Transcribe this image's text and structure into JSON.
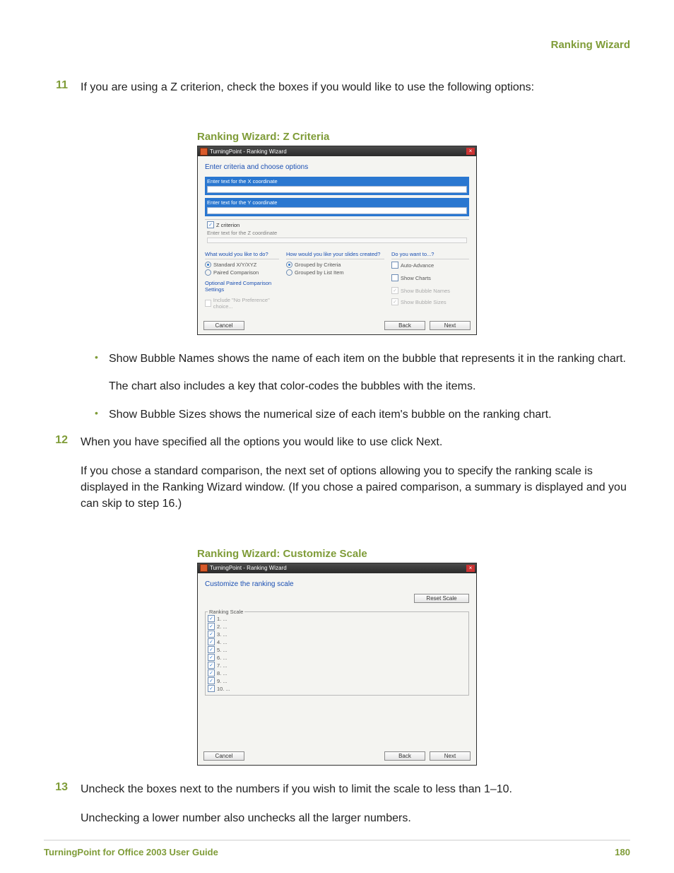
{
  "running_head": "Ranking Wizard",
  "step11": {
    "num": "11",
    "text": "If you are using a Z criterion, check the boxes if you would like to use the following options:"
  },
  "figure1": {
    "caption": "Ranking Wizard: Z Criteria",
    "title_bar": "TurningPoint - Ranking Wizard",
    "heading": "Enter criteria and choose options",
    "x_label": "Enter text for the X coordinate",
    "y_label": "Enter text for the Y coordinate",
    "z_check": "Z criterion",
    "z_label": "Enter text for the Z coordinate",
    "col1_head": "What would you like to do?",
    "col1_opt1": "Standard X/Y/XYZ",
    "col1_opt2": "Paired Comparison",
    "col1_sub": "Optional Paired Comparison Settings",
    "col1_sub_opt": "Include \"No Preference\" choice...",
    "col2_head": "How would you like your slides created?",
    "col2_opt1": "Grouped by Criteria",
    "col2_opt2": "Grouped by List Item",
    "col3_head": "Do you want to...?",
    "col3_opt1": "Auto-Advance",
    "col3_opt2": "Show Charts",
    "col3_opt3": "Show Bubble Names",
    "col3_opt4": "Show Bubble Sizes",
    "btn_cancel": "Cancel",
    "btn_back": "Back",
    "btn_next": "Next"
  },
  "bullet1_a": "Show Bubble Names shows the name of each item on the bubble that represents it in the ranking chart.",
  "bullet1_b": "The chart also includes a key that color-codes the bubbles with the items.",
  "bullet2": "Show Bubble Sizes shows the numerical size of each item's bubble on the ranking chart.",
  "step12": {
    "num": "12",
    "a": "When you have specified all the options you would like to use click Next.",
    "b": "If you chose a standard comparison, the next set of options allowing you to specify the ranking scale is displayed in the Ranking Wizard window. (If you chose a paired comparison, a summary is displayed and you can skip to step 16.)"
  },
  "figure2": {
    "caption": "Ranking Wizard: Customize Scale",
    "title_bar": "TurningPoint - Ranking Wizard",
    "heading": "Customize the ranking scale",
    "reset": "Reset Scale",
    "group_label": "Ranking Scale",
    "items": [
      "1.  ...",
      "2.  ...",
      "3.  ...",
      "4.  ...",
      "5.  ...",
      "6.  ...",
      "7.  ...",
      "8.  ...",
      "9.  ...",
      "10. ..."
    ],
    "btn_cancel": "Cancel",
    "btn_back": "Back",
    "btn_next": "Next"
  },
  "step13": {
    "num": "13",
    "a": "Uncheck the boxes next to the numbers if you wish to limit the scale to less than 1–10.",
    "b": "Unchecking a lower number also unchecks all the larger numbers."
  },
  "footer_left": "TurningPoint for Office 2003 User Guide",
  "footer_right": "180"
}
